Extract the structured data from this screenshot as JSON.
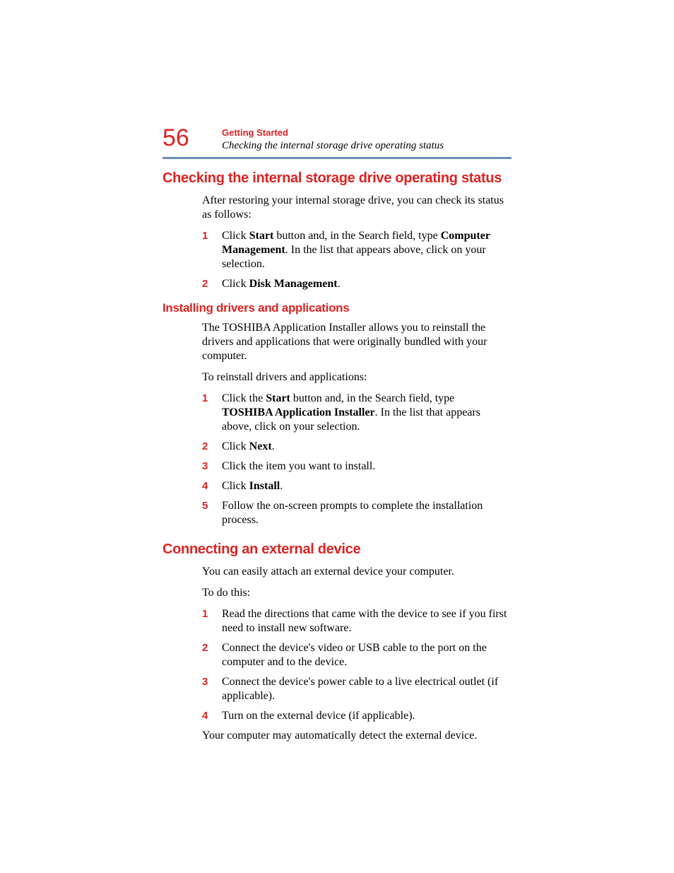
{
  "header": {
    "page_number": "56",
    "chapter": "Getting Started",
    "section": "Checking the internal storage drive operating status"
  },
  "s1": {
    "heading": "Checking the internal storage drive operating status",
    "p1": "After restoring your internal storage drive, you can check its status as follows:",
    "steps": {
      "n1": "1",
      "t1a": "Click ",
      "t1b": "Start",
      "t1c": " button and, in the Search field, type ",
      "t1d": "Computer Management",
      "t1e": ". In the list that appears above, click on your selection.",
      "n2": "2",
      "t2a": "Click ",
      "t2b": "Disk Management",
      "t2c": "."
    }
  },
  "s2": {
    "heading": "Installing drivers and applications",
    "p1": "The TOSHIBA Application Installer allows you to reinstall the drivers and applications that were originally bundled with your computer.",
    "p2": "To reinstall drivers and applications:",
    "steps": {
      "n1": "1",
      "t1a": "Click the ",
      "t1b": "Start",
      "t1c": " button and, in the Search field, type ",
      "t1d": "TOSHIBA Application Installer",
      "t1e": ". In the list that appears above, click on your selection.",
      "n2": "2",
      "t2a": "Click ",
      "t2b": "Next",
      "t2c": ".",
      "n3": "3",
      "t3": "Click the item you want to install.",
      "n4": "4",
      "t4a": "Click ",
      "t4b": "Install",
      "t4c": ".",
      "n5": "5",
      "t5": "Follow the on-screen prompts to complete the installation process."
    }
  },
  "s3": {
    "heading": "Connecting an external device",
    "p1": "You can easily attach an external device your computer.",
    "p2": "To do this:",
    "steps": {
      "n1": "1",
      "t1": "Read the directions that came with the device to see if you first need to install new software.",
      "n2": "2",
      "t2": "Connect the device's video or USB cable to the port on the computer and to the device.",
      "n3": "3",
      "t3": "Connect the device's power cable to a live electrical outlet (if applicable).",
      "n4": "4",
      "t4": "Turn on the external device (if applicable)."
    },
    "p3": "Your computer may automatically detect the external device."
  }
}
